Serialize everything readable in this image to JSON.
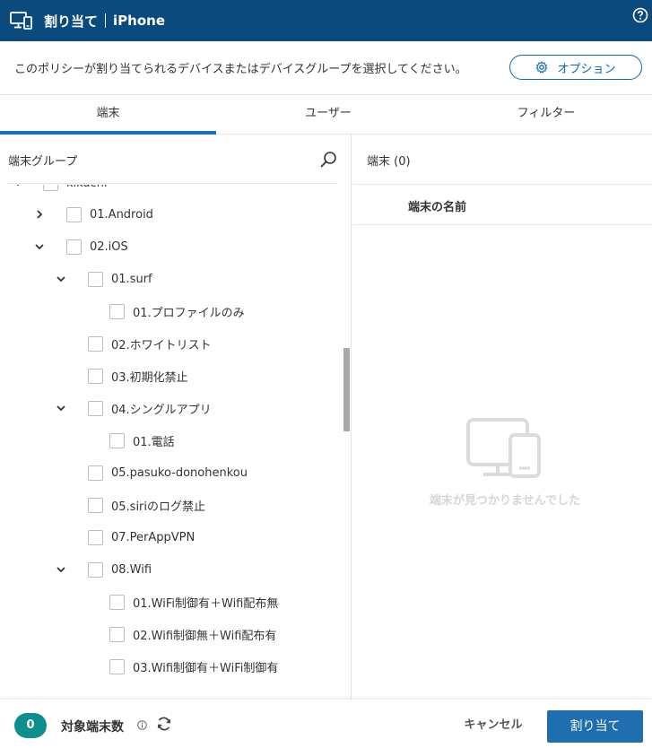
{
  "header": {
    "title": "割り当て",
    "subtitle": "iPhone"
  },
  "description": "このポリシーが割り当てられるデバイスまたはデバイスグループを選択してください。",
  "option_button": "オプション",
  "tabs": [
    {
      "label": "端末",
      "active": true
    },
    {
      "label": "ユーザー",
      "active": false
    },
    {
      "label": "フィルター",
      "active": false
    }
  ],
  "left": {
    "title": "端末グループ",
    "tree": [
      {
        "label": "kikuchi",
        "expanded": true
      },
      {
        "label": "01.Android",
        "expanded": false
      },
      {
        "label": "02.iOS",
        "expanded": true
      },
      {
        "label": "01.surf",
        "expanded": true
      },
      {
        "label": "01.プロファイルのみ"
      },
      {
        "label": "02.ホワイトリスト"
      },
      {
        "label": "03.初期化禁止"
      },
      {
        "label": "04.シングルアプリ",
        "expanded": true
      },
      {
        "label": "01.電話"
      },
      {
        "label": "05.pasuko-donohenkou"
      },
      {
        "label": "05.siriのログ禁止"
      },
      {
        "label": "07.PerAppVPN"
      },
      {
        "label": "08.Wifi",
        "expanded": true
      },
      {
        "label": "01.WiFi制御有＋Wifi配布無"
      },
      {
        "label": "02.Wifi制御無＋Wifi配布有"
      },
      {
        "label": "03.Wifi制御有＋WiFi制御有"
      }
    ]
  },
  "right": {
    "title": "端末 (0)",
    "column_name": "端末の名前",
    "empty_message": "端末が見つかりませんでした"
  },
  "footer": {
    "count": "0",
    "count_label": "対象端末数",
    "cancel": "キャンセル",
    "assign": "割り当て"
  },
  "colors": {
    "header_bg": "#0a4a7c",
    "accent": "#1f6fb0",
    "badge": "#0e8f8f"
  }
}
